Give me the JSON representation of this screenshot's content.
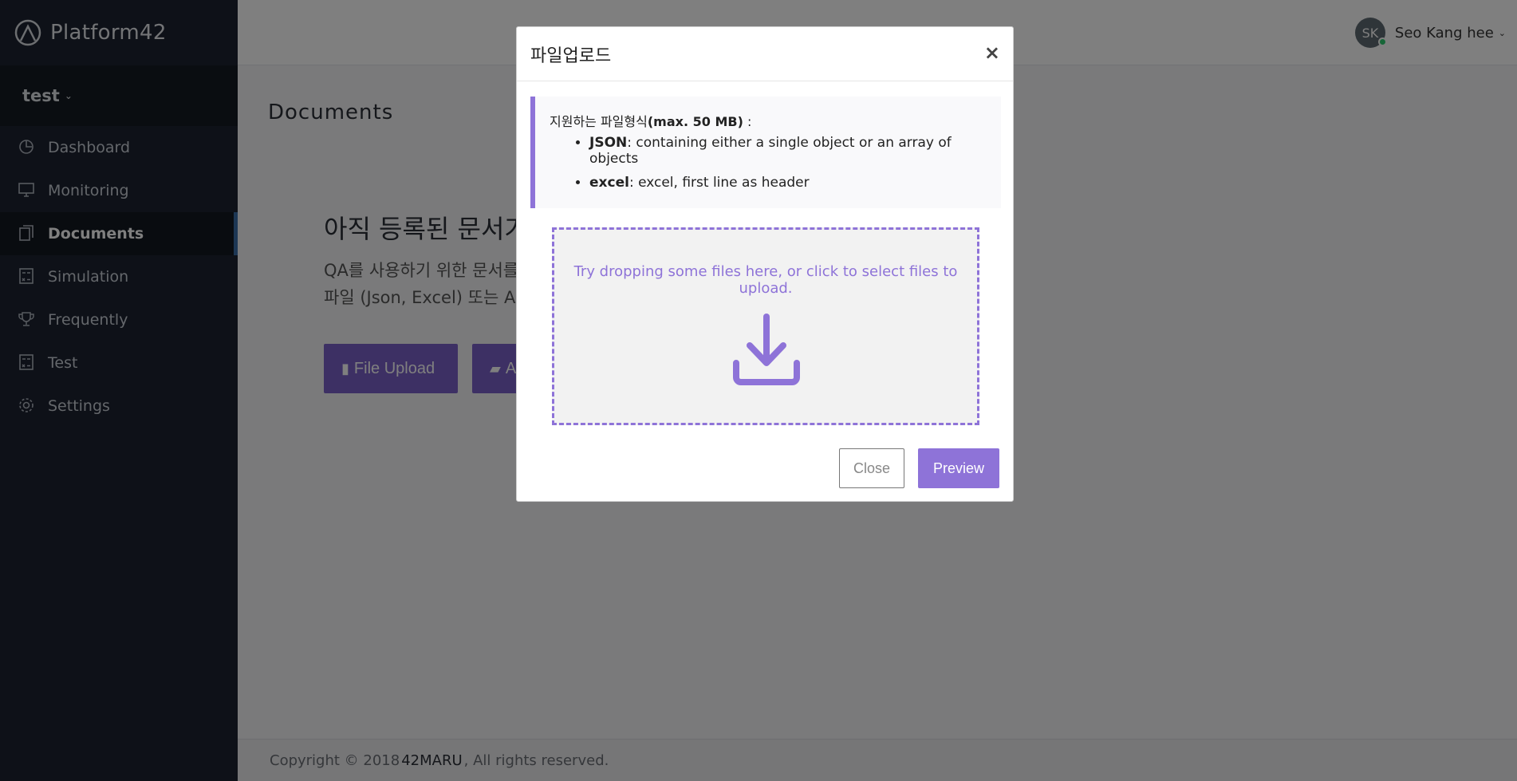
{
  "brand": {
    "name": "Platform42"
  },
  "project": {
    "name": "test"
  },
  "sidebar": {
    "items": [
      {
        "label": "Dashboard",
        "icon": "dashboard-icon",
        "active": false
      },
      {
        "label": "Monitoring",
        "icon": "monitor-icon",
        "active": false
      },
      {
        "label": "Documents",
        "icon": "documents-icon",
        "active": true
      },
      {
        "label": "Simulation",
        "icon": "calculator-icon",
        "active": false
      },
      {
        "label": "Frequently",
        "icon": "trophy-icon",
        "active": false
      },
      {
        "label": "Test",
        "icon": "calculator-icon",
        "active": false
      },
      {
        "label": "Settings",
        "icon": "gear-icon",
        "active": false
      }
    ]
  },
  "user": {
    "initials": "SK",
    "name": "Seo Kang hee"
  },
  "page": {
    "title": "Documents",
    "empty_title": "아직 등록된 문서가",
    "empty_desc_line1": "QA를 사용하기 위한 문서를",
    "empty_desc_line2": "파일 (Json, Excel) 또는 AP",
    "file_upload_label": "File Upload",
    "api_label": "A"
  },
  "footer": {
    "prefix": "Copyright © 2018 ",
    "company": "42MARU",
    "suffix": ", All rights reserved."
  },
  "modal": {
    "title": "파일업로드",
    "close_symbol": "×",
    "notice": {
      "intro": "지원하는 파일형식",
      "max": "(max. 50 MB)",
      "colon": " :",
      "formats": [
        {
          "name": "JSON",
          "desc": ": containing either a single object or an array of objects"
        },
        {
          "name": "excel",
          "desc": ": excel, first line as header"
        }
      ]
    },
    "dropzone_text": "Try dropping some files here, or click to select files to upload.",
    "close_label": "Close",
    "preview_label": "Preview"
  },
  "colors": {
    "accent": "#8e73d8",
    "sidebar_bg": "#1c2331",
    "button_primary": "#7b61c9"
  }
}
